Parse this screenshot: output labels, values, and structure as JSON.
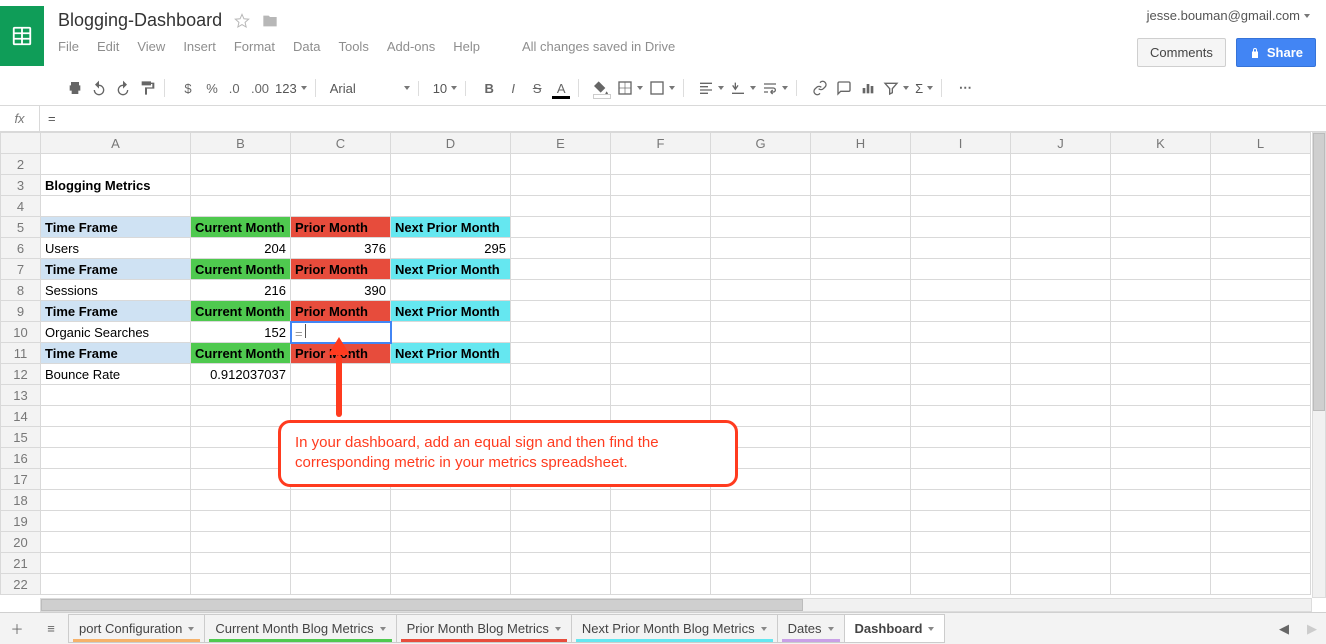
{
  "app": {
    "title": "Blogging-Dashboard",
    "save_msg": "All changes saved in Drive"
  },
  "user": {
    "email": "jesse.bouman@gmail.com"
  },
  "buttons": {
    "comments": "Comments",
    "share": "Share"
  },
  "menus": [
    "File",
    "Edit",
    "View",
    "Insert",
    "Format",
    "Data",
    "Tools",
    "Add-ons",
    "Help"
  ],
  "toolbar": {
    "font": "Arial",
    "size": "10"
  },
  "fx": {
    "value": "="
  },
  "cols": [
    "A",
    "B",
    "C",
    "D",
    "E",
    "F",
    "G",
    "H",
    "I",
    "J",
    "K",
    "L"
  ],
  "rows": [
    "2",
    "3",
    "4",
    "5",
    "6",
    "7",
    "8",
    "9",
    "10",
    "11",
    "12",
    "13",
    "14",
    "15",
    "16",
    "17",
    "18",
    "19",
    "20",
    "21",
    "22"
  ],
  "cells": {
    "section_title": "Blogging Metrics",
    "tf_label": "Time Frame",
    "cm_label": "Current Month",
    "pm_label": "Prior Month",
    "np_label": "Next Prior Month",
    "users_label": "Users",
    "users_cm": "204",
    "users_pm": "376",
    "users_np": "295",
    "sessions_label": "Sessions",
    "sessions_cm": "216",
    "sessions_pm": "390",
    "organic_label": "Organic Searches",
    "organic_cm": "152",
    "organic_pm_editing": "=",
    "bounce_label": "Bounce Rate",
    "bounce_cm": "0.912037037"
  },
  "annotation": {
    "text": "In your dashboard, add an equal sign and then find the corresponding metric in your metrics spreadsheet."
  },
  "tabs": {
    "items": [
      {
        "label": "port Configuration",
        "color": "#f5b26b"
      },
      {
        "label": "Current Month Blog Metrics",
        "color": "#4fc94f"
      },
      {
        "label": "Prior Month Blog Metrics",
        "color": "#e74c3c"
      },
      {
        "label": "Next Prior Month Blog Metrics",
        "color": "#65e7f0"
      },
      {
        "label": "Dates",
        "color": "#c9a0e6"
      },
      {
        "label": "Dashboard",
        "color": "",
        "active": true
      }
    ]
  }
}
